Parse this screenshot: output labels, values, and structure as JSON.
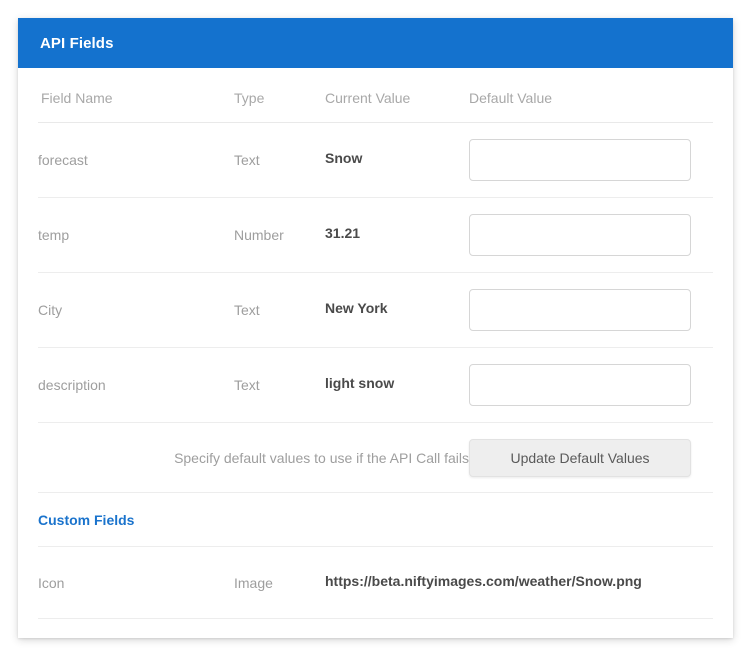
{
  "card": {
    "header": {
      "title": "API Fields",
      "background_color": "#1472CE",
      "text_color": "#ffffff"
    }
  },
  "table": {
    "columns": [
      "Field Name",
      "Type",
      "Current Value",
      "Default Value"
    ],
    "api_fields": [
      {
        "field_name": "forecast",
        "type": "Text",
        "current_value": "Snow",
        "default_value": "",
        "default_placeholder": ""
      },
      {
        "field_name": "temp",
        "type": "Number",
        "current_value": "31.21",
        "default_value": "",
        "default_placeholder": ""
      },
      {
        "field_name": "City",
        "type": "Text",
        "current_value": "New York",
        "default_value": "",
        "default_placeholder": ""
      },
      {
        "field_name": "description",
        "type": "Text",
        "current_value": "light snow",
        "default_value": "",
        "default_placeholder": ""
      }
    ]
  },
  "actions": {
    "note": "Specify default values to use if the API Call fails",
    "update_button_label": "Update Default Values"
  },
  "custom_fields": {
    "heading": "Custom Fields",
    "heading_color": "#1a73cc",
    "rows": [
      {
        "field_name": "Icon",
        "type": "Image",
        "current_value": "https://beta.niftyimages.com/weather/Snow.png"
      }
    ]
  }
}
